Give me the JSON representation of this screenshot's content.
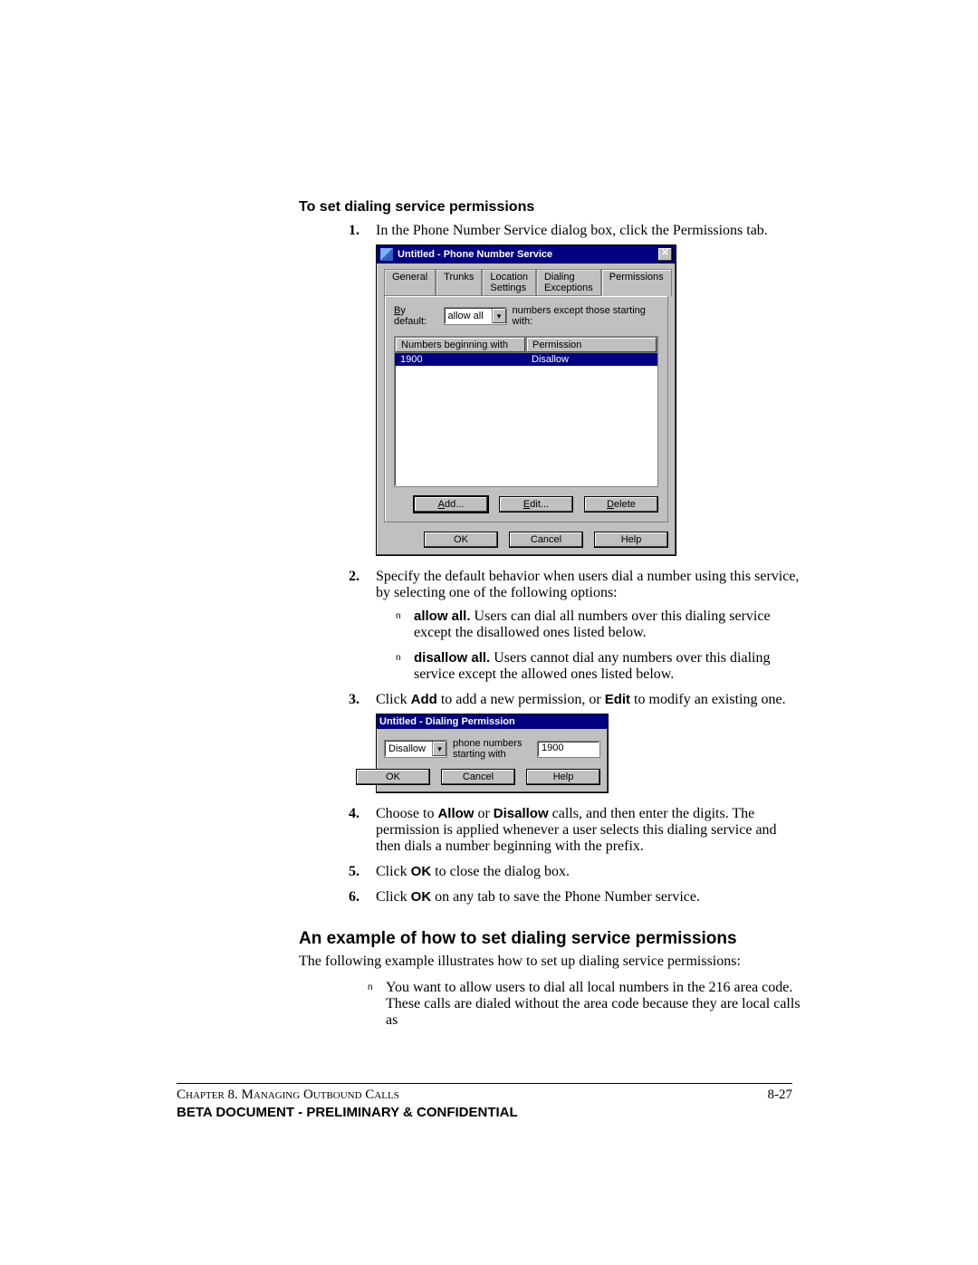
{
  "heading1": "To set dialing service permissions",
  "steps": {
    "s1_num": "1.",
    "s1_text": "In the Phone Number Service dialog box, click the Permissions tab.",
    "s2_num": "2.",
    "s2_text": "Specify the default behavior when users dial a number using this service, by selecting one of the following options:",
    "s2_b1_bold": "allow all.",
    "s2_b1_text": " Users can dial all numbers over this dialing service except the disallowed ones listed below.",
    "s2_b2_bold": "disallow all.",
    "s2_b2_text": " Users cannot dial any numbers over this dialing service except the allowed ones listed below.",
    "s3_num": "3.",
    "s3_pre": "Click ",
    "s3_add": "Add",
    "s3_mid": " to add a new permission, or ",
    "s3_edit": "Edit",
    "s3_post": " to modify an existing one.",
    "s4_num": "4.",
    "s4_pre": "Choose to ",
    "s4_allow": "Allow",
    "s4_or": " or ",
    "s4_disallow": "Disallow",
    "s4_post": " calls, and then enter the digits. The permission is applied whenever a user selects this dialing service and then dials a number beginning with the prefix.",
    "s5_num": "5.",
    "s5_pre": "Click ",
    "s5_ok": "OK",
    "s5_post": " to close the dialog box.",
    "s6_num": "6.",
    "s6_pre": "Click ",
    "s6_ok": "OK",
    "s6_post": " on any tab to save the Phone Number service."
  },
  "heading2": "An example of how to set dialing service permissions",
  "example_intro": "The following example illustrates how to set up dialing service permissions:",
  "example_b1": "You want to allow users to dial all local numbers in the 216 area code. These calls are dialed without the area code because they are local calls as",
  "dialog1": {
    "title": "Untitled - Phone Number Service",
    "tabs": {
      "t1": "General",
      "t2": "Trunks",
      "t3": "Location Settings",
      "t4": "Dialing Exceptions",
      "t5": "Permissions"
    },
    "label_pre": "y default:",
    "label_letter": "B",
    "combo_value": "allow all",
    "label_post": "numbers except those starting with:",
    "col1": "Numbers beginning with",
    "col2": "Permission",
    "row_num": "1900",
    "row_perm": "Disallow",
    "btn_add_u": "A",
    "btn_add": "dd...",
    "btn_edit_u": "E",
    "btn_edit": "dit...",
    "btn_del_u": "D",
    "btn_del": "elete",
    "btn_ok": "OK",
    "btn_cancel": "Cancel",
    "btn_help": "Help"
  },
  "dialog2": {
    "title": "Untitled - Dialing Permission",
    "combo_value": "Disallow",
    "label": "phone numbers starting with",
    "textbox_value": "1900",
    "btn_ok": "OK",
    "btn_cancel": "Cancel",
    "btn_help": "Help"
  },
  "footer": {
    "chapter": "Chapter 8. Managing Outbound Calls",
    "pagenum": "8-27",
    "confidential": "BETA DOCUMENT - PRELIMINARY & CONFIDENTIAL"
  }
}
